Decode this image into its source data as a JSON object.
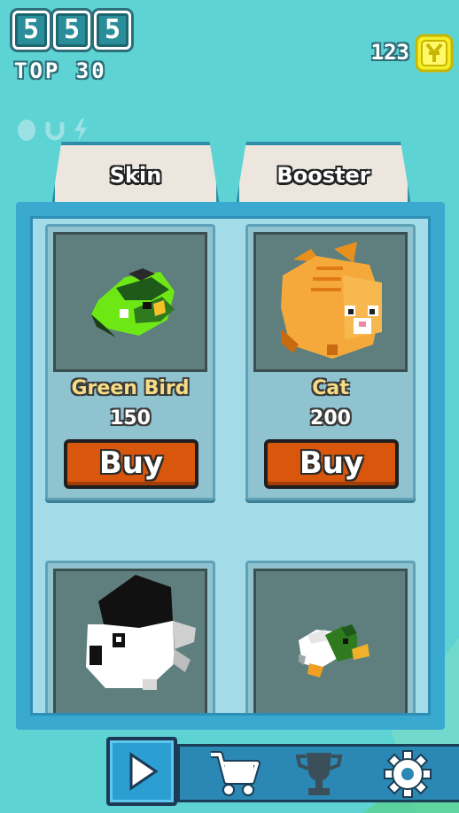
{
  "hud": {
    "score_digits": [
      "5",
      "5",
      "5"
    ],
    "top_label": "TOP 30",
    "coin_count": "123",
    "powerup_icons": [
      "shield-icon",
      "magnet-icon",
      "lightning-icon"
    ]
  },
  "tabs": {
    "skin": "Skin",
    "booster": "Booster"
  },
  "shop": {
    "items": [
      {
        "name": "Green Bird",
        "price": "150",
        "buy_label": "Buy",
        "icon": "green-bird-icon"
      },
      {
        "name": "Cat",
        "price": "200",
        "buy_label": "Buy",
        "icon": "cat-icon"
      },
      {
        "name": "",
        "price": "",
        "buy_label": "",
        "icon": "penguin-icon"
      },
      {
        "name": "",
        "price": "",
        "buy_label": "",
        "icon": "duck-icon"
      }
    ]
  },
  "nav": {
    "icons": [
      "play-icon",
      "cart-icon",
      "trophy-icon",
      "gear-icon"
    ]
  },
  "colors": {
    "background": "#5ed3d3",
    "panel": "#3aa9d0",
    "buy_button": "#d8570d",
    "item_name": "#f7dc86",
    "coin": "#f2ee2a"
  }
}
